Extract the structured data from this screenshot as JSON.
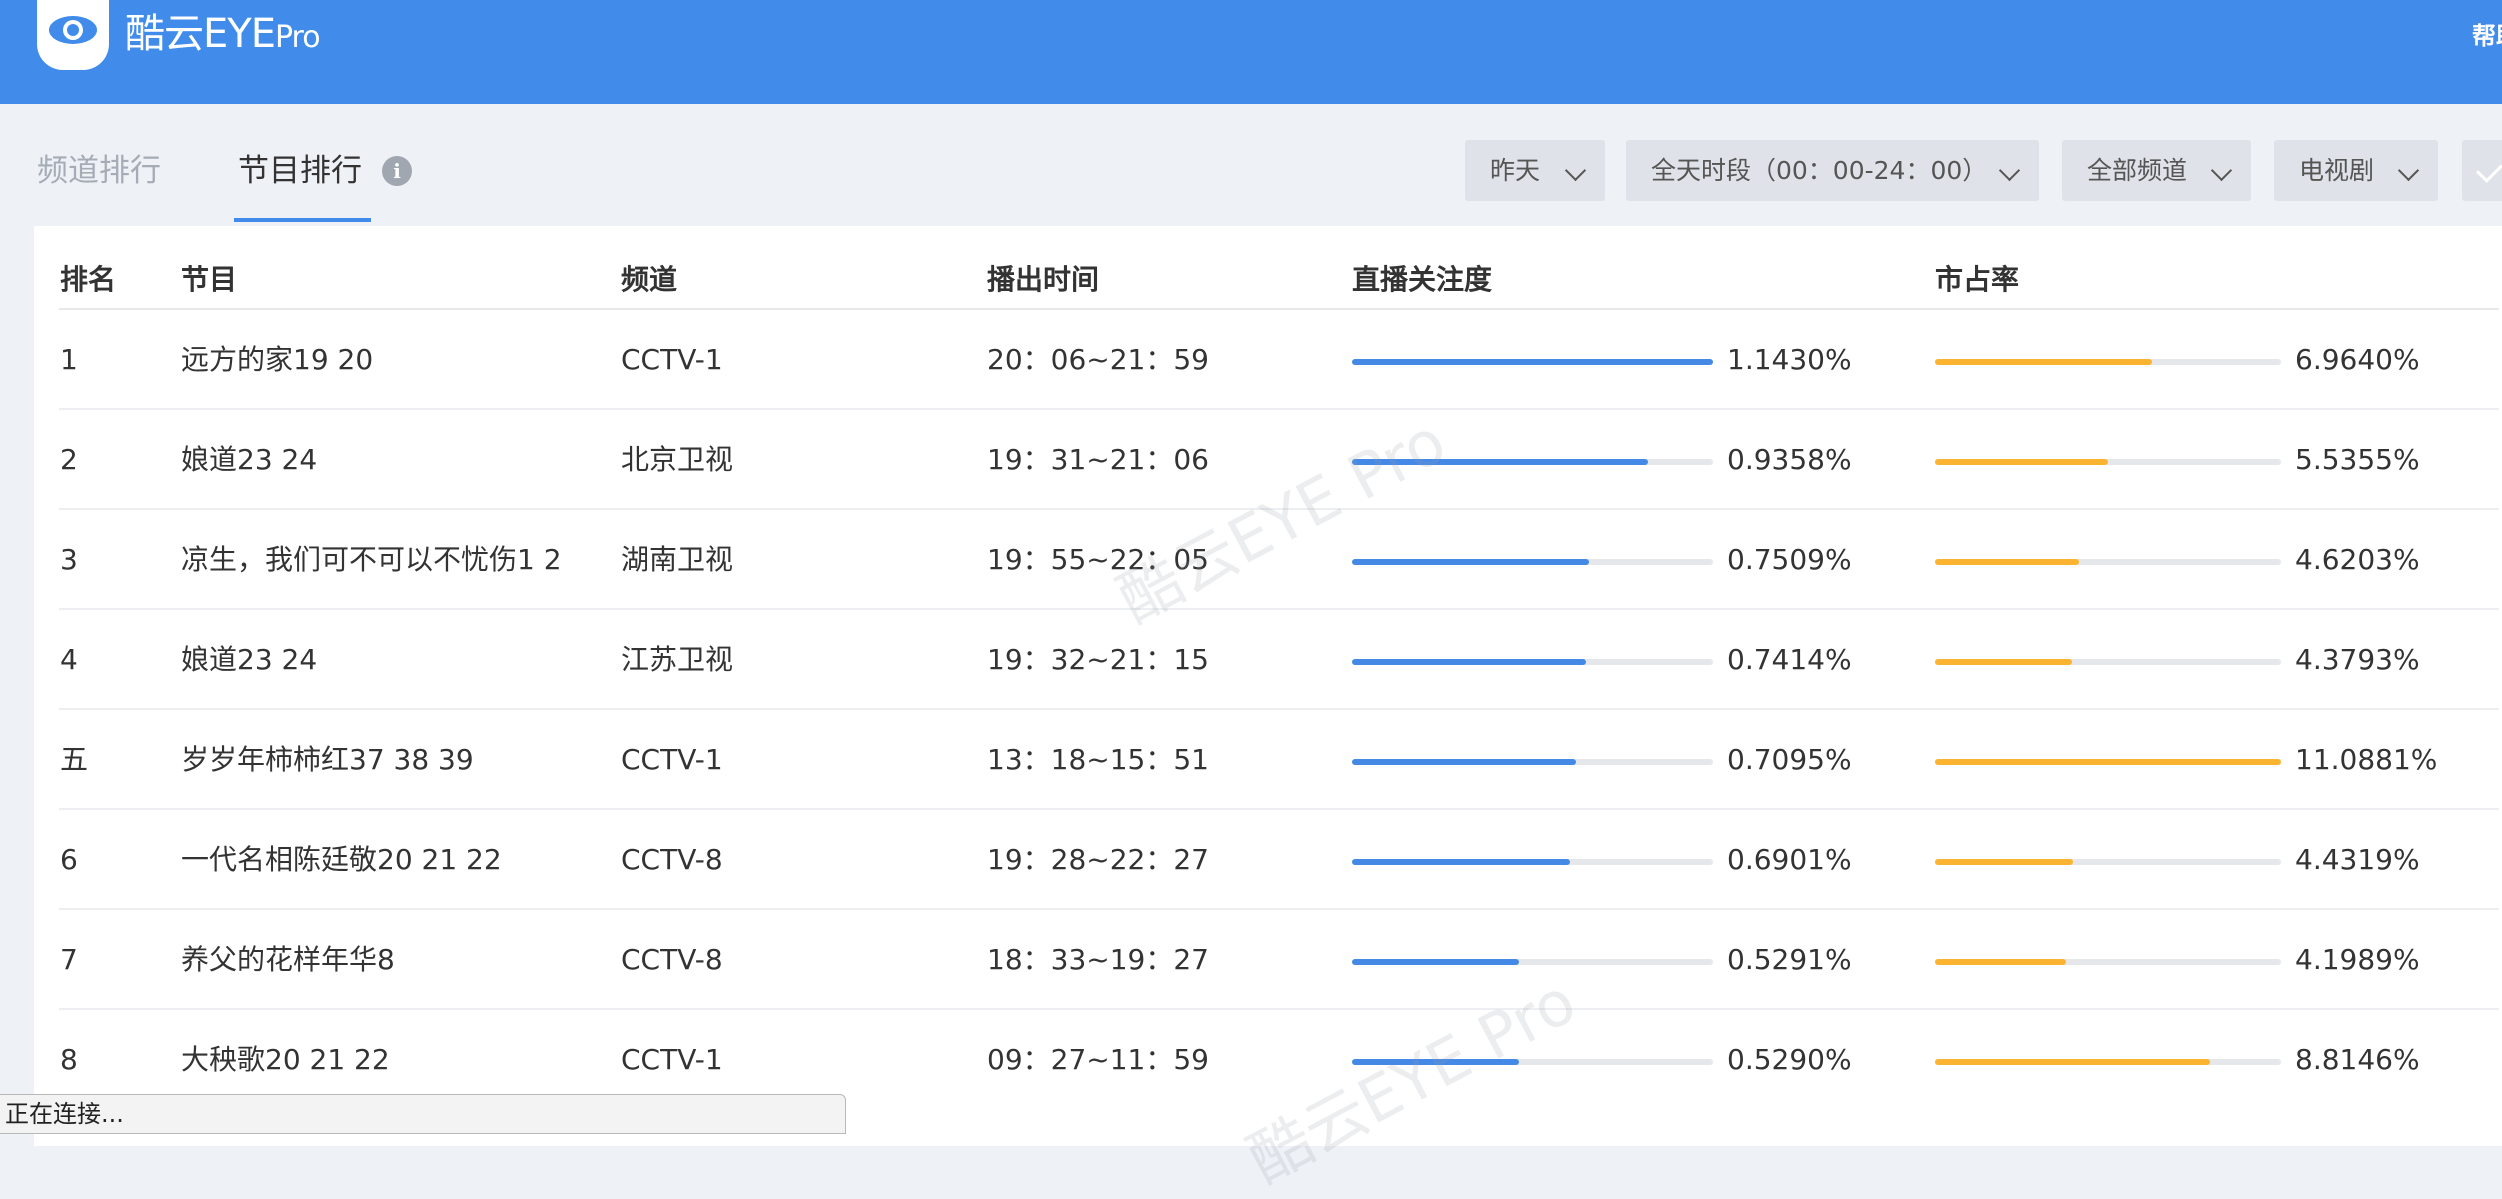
{
  "header": {
    "logo_text": "酷云EYE",
    "logo_suffix": "Pro",
    "help_label": "帮助"
  },
  "tabs": [
    {
      "label": "频道排行",
      "active": false
    },
    {
      "label": "节目排行",
      "active": true
    }
  ],
  "info_icon": "i",
  "filters": {
    "date": "昨天",
    "timeslot": "全天时段（00：00-24：00）",
    "channels": "全部频道",
    "genre": "电视剧"
  },
  "table": {
    "columns": [
      "排名",
      "节目",
      "频道",
      "播出时间",
      "直播关注度",
      "市占率"
    ],
    "rows": [
      {
        "rank": "1",
        "program": "远方的家19 20",
        "channel": "CCTV-1",
        "time": "20：06~21：59",
        "attention": "1.1430%",
        "attention_level": 1.0,
        "share": "6.9640%",
        "share_level": 0.628
      },
      {
        "rank": "2",
        "program": "娘道23 24",
        "channel": "北京卫视",
        "time": "19：31~21：06",
        "attention": "0.9358%",
        "attention_level": 0.819,
        "share": "5.5355%",
        "share_level": 0.499
      },
      {
        "rank": "3",
        "program": "凉生，我们可不可以不忧伤1 2",
        "channel": "湖南卫视",
        "time": "19：55~22：05",
        "attention": "0.7509%",
        "attention_level": 0.657,
        "share": "4.6203%",
        "share_level": 0.417
      },
      {
        "rank": "4",
        "program": "娘道23 24",
        "channel": "江苏卫视",
        "time": "19：32~21：15",
        "attention": "0.7414%",
        "attention_level": 0.649,
        "share": "4.3793%",
        "share_level": 0.395
      },
      {
        "rank": "五",
        "program": "岁岁年柿柿红37 38 39",
        "channel": "CCTV-1",
        "time": "13：18~15：51",
        "attention": "0.7095%",
        "attention_level": 0.621,
        "share": "11.0881%",
        "share_level": 1.0
      },
      {
        "rank": "6",
        "program": "一代名相陈廷敬20 21 22",
        "channel": "CCTV-8",
        "time": "19：28~22：27",
        "attention": "0.6901%",
        "attention_level": 0.604,
        "share": "4.4319%",
        "share_level": 0.4
      },
      {
        "rank": "7",
        "program": "养父的花样年华8",
        "channel": "CCTV-8",
        "time": "18：33~19：27",
        "attention": "0.5291%",
        "attention_level": 0.463,
        "share": "4.1989%",
        "share_level": 0.379
      },
      {
        "rank": "8",
        "program": "大秧歌20 21 22",
        "channel": "CCTV-1",
        "time": "09：27~11：59",
        "attention": "0.5290%",
        "attention_level": 0.463,
        "share": "8.8146%",
        "share_level": 0.795
      }
    ]
  },
  "watermark": "酷云EYE Pro",
  "status_text": "正在连接...",
  "colors": {
    "header": "#418ceb",
    "attention_bar": "#4589e6",
    "share_bar": "#fbb431",
    "track": "#e5e7ea"
  }
}
